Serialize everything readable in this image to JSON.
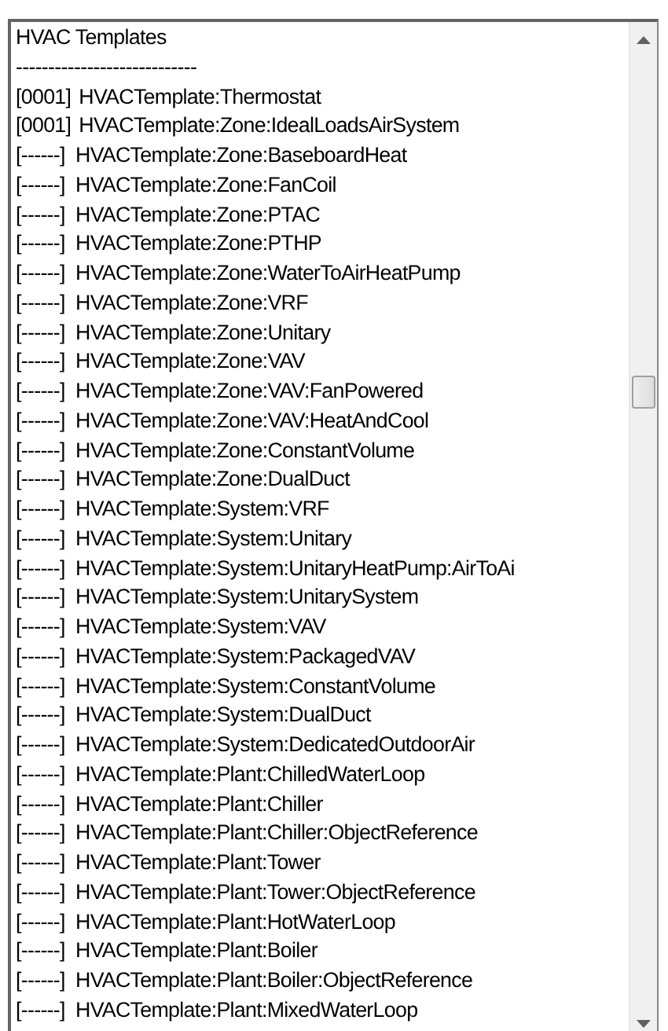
{
  "list": {
    "title": "HVAC Templates",
    "separator": "----------------------------",
    "items": [
      {
        "count": "[0001]",
        "name": "HVACTemplate:Thermostat"
      },
      {
        "count": "[0001]",
        "name": "HVACTemplate:Zone:IdealLoadsAirSystem"
      },
      {
        "count": "[------]",
        "name": "HVACTemplate:Zone:BaseboardHeat"
      },
      {
        "count": "[------]",
        "name": "HVACTemplate:Zone:FanCoil"
      },
      {
        "count": "[------]",
        "name": "HVACTemplate:Zone:PTAC"
      },
      {
        "count": "[------]",
        "name": "HVACTemplate:Zone:PTHP"
      },
      {
        "count": "[------]",
        "name": "HVACTemplate:Zone:WaterToAirHeatPump"
      },
      {
        "count": "[------]",
        "name": "HVACTemplate:Zone:VRF"
      },
      {
        "count": "[------]",
        "name": "HVACTemplate:Zone:Unitary"
      },
      {
        "count": "[------]",
        "name": "HVACTemplate:Zone:VAV"
      },
      {
        "count": "[------]",
        "name": "HVACTemplate:Zone:VAV:FanPowered"
      },
      {
        "count": "[------]",
        "name": "HVACTemplate:Zone:VAV:HeatAndCool"
      },
      {
        "count": "[------]",
        "name": "HVACTemplate:Zone:ConstantVolume"
      },
      {
        "count": "[------]",
        "name": "HVACTemplate:Zone:DualDuct"
      },
      {
        "count": "[------]",
        "name": "HVACTemplate:System:VRF"
      },
      {
        "count": "[------]",
        "name": "HVACTemplate:System:Unitary"
      },
      {
        "count": "[------]",
        "name": "HVACTemplate:System:UnitaryHeatPump:AirToAi"
      },
      {
        "count": "[------]",
        "name": "HVACTemplate:System:UnitarySystem"
      },
      {
        "count": "[------]",
        "name": "HVACTemplate:System:VAV"
      },
      {
        "count": "[------]",
        "name": "HVACTemplate:System:PackagedVAV"
      },
      {
        "count": "[------]",
        "name": "HVACTemplate:System:ConstantVolume"
      },
      {
        "count": "[------]",
        "name": "HVACTemplate:System:DualDuct"
      },
      {
        "count": "[------]",
        "name": "HVACTemplate:System:DedicatedOutdoorAir"
      },
      {
        "count": "[------]",
        "name": "HVACTemplate:Plant:ChilledWaterLoop"
      },
      {
        "count": "[------]",
        "name": "HVACTemplate:Plant:Chiller"
      },
      {
        "count": "[------]",
        "name": "HVACTemplate:Plant:Chiller:ObjectReference"
      },
      {
        "count": "[------]",
        "name": "HVACTemplate:Plant:Tower"
      },
      {
        "count": "[------]",
        "name": "HVACTemplate:Plant:Tower:ObjectReference"
      },
      {
        "count": "[------]",
        "name": "HVACTemplate:Plant:HotWaterLoop"
      },
      {
        "count": "[------]",
        "name": "HVACTemplate:Plant:Boiler"
      },
      {
        "count": "[------]",
        "name": "HVACTemplate:Plant:Boiler:ObjectReference"
      },
      {
        "count": "[------]",
        "name": "HVACTemplate:Plant:MixedWaterLoop"
      }
    ]
  }
}
